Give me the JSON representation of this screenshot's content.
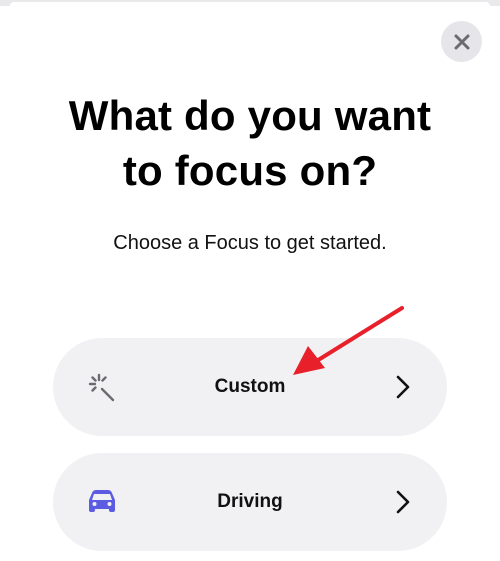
{
  "sheet": {
    "close_icon": "close-icon",
    "title_line1": "What do you want",
    "title_line2": "to focus on?",
    "subtitle": "Choose a Focus to get started."
  },
  "options": [
    {
      "label": "Custom",
      "icon": "sparkle-wand-icon",
      "chevron": "chevron-right-icon"
    },
    {
      "label": "Driving",
      "icon": "car-icon",
      "chevron": "chevron-right-icon"
    }
  ],
  "colors": {
    "background": "#ffffff",
    "option_bg": "#f1f1f3",
    "close_bg": "#e6e6ea",
    "driving_icon": "#5b5ce2",
    "annotation_arrow": "#e8202a"
  }
}
